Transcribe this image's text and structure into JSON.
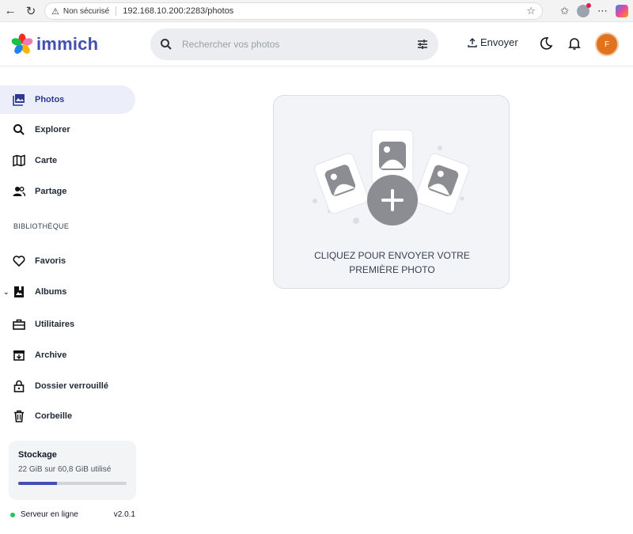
{
  "browser": {
    "security_label": "Non sécurisé",
    "url": "192.168.10.200:2283/photos"
  },
  "header": {
    "app_name": "immich",
    "search_placeholder": "Rechercher vos photos",
    "upload_label": "Envoyer",
    "user_initial": "F"
  },
  "sidebar": {
    "items": [
      {
        "label": "Photos",
        "icon": "photos-icon",
        "active": true
      },
      {
        "label": "Explorer",
        "icon": "search-icon"
      },
      {
        "label": "Carte",
        "icon": "map-icon"
      },
      {
        "label": "Partage",
        "icon": "people-icon"
      }
    ],
    "library_label": "BIBLIOTHÈQUE",
    "library_items": [
      {
        "label": "Favoris",
        "icon": "heart-icon"
      },
      {
        "label": "Albums",
        "icon": "album-icon"
      },
      {
        "label": "Utilitaires",
        "icon": "toolbox-icon"
      },
      {
        "label": "Archive",
        "icon": "archive-icon"
      },
      {
        "label": "Dossier verrouillé",
        "icon": "lock-icon"
      },
      {
        "label": "Corbeille",
        "icon": "trash-icon"
      }
    ],
    "storage": {
      "title": "Stockage",
      "usage": "22 GiB sur 60,8 GiB utilisé",
      "used_fraction": 0.36
    },
    "server_status": "Serveur en ligne",
    "version": "v2.0.1"
  },
  "main": {
    "upload_prompt": "CLIQUEZ POUR ENVOYER VOTRE PREMIÈRE PHOTO"
  },
  "colors": {
    "brand": "#4250af",
    "avatar": "#e0731f",
    "online": "#22c55e"
  }
}
